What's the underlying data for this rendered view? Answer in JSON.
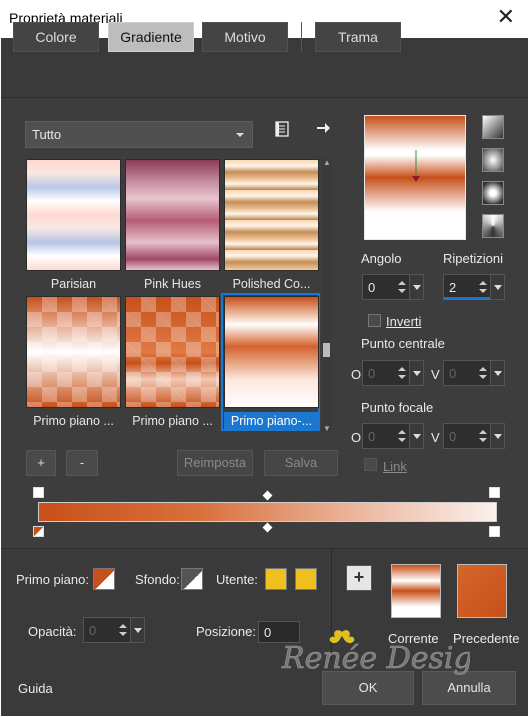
{
  "window": {
    "title": "Proprietà materiali",
    "close_glyph": "✕"
  },
  "tabs": [
    {
      "label": "Colore",
      "active": false
    },
    {
      "label": "Gradiente",
      "active": true
    },
    {
      "label": "Motivo",
      "active": false
    },
    {
      "label": "Trama",
      "active": false
    }
  ],
  "category_select": {
    "value": "Tutto"
  },
  "presets": [
    {
      "label": "Parisian"
    },
    {
      "label": "Pink Hues"
    },
    {
      "label": "Polished Co..."
    },
    {
      "label": "Primo piano ..."
    },
    {
      "label": "Primo piano ..."
    },
    {
      "label": "Primo piano-...",
      "selected": true
    }
  ],
  "buttons": {
    "add": "+",
    "remove": "-",
    "reset": "Reimposta",
    "save": "Salva"
  },
  "angle": {
    "label": "Angolo",
    "value": "0"
  },
  "repeats": {
    "label": "Ripetizioni",
    "value": "2"
  },
  "invert": {
    "label": "Inverti",
    "checked": false
  },
  "center": {
    "label": "Punto centrale",
    "o_label": "O",
    "v_label": "V",
    "o_value": "0",
    "v_value": "0"
  },
  "focus": {
    "label": "Punto focale",
    "o_label": "O",
    "v_label": "V",
    "o_value": "0",
    "v_value": "0"
  },
  "link": {
    "label": "Link"
  },
  "colors": {
    "foreground": "#c8501a",
    "accent": "#f0c020",
    "selection": "#1a78d0"
  },
  "materials": {
    "fg_label": "Primo piano:",
    "bg_label": "Sfondo:",
    "user_label": "Utente:",
    "opacity_label": "Opacità:",
    "opacity_value": "0",
    "position_label": "Posizione:",
    "position_value": "0"
  },
  "compare": {
    "current": "Corrente",
    "previous": "Precedente",
    "add_glyph": "+"
  },
  "watermark": "Renée Design",
  "footer": {
    "help": "Guida",
    "ok": "OK",
    "cancel": "Annulla"
  }
}
